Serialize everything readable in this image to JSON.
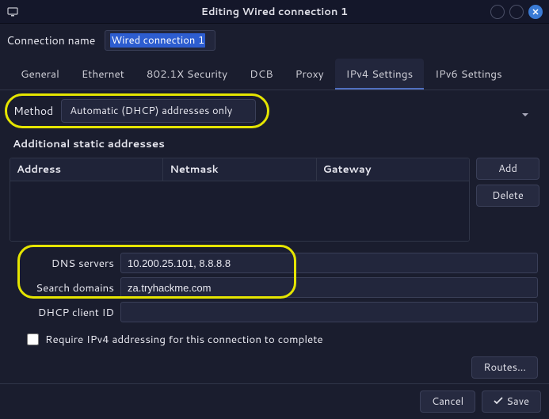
{
  "window": {
    "title": "Editing Wired connection 1"
  },
  "connection": {
    "name_label": "Connection name",
    "name_value": "Wired connection 1"
  },
  "tabs": {
    "general": "General",
    "ethernet": "Ethernet",
    "security": "802.1X Security",
    "dcb": "DCB",
    "proxy": "Proxy",
    "ipv4": "IPv4 Settings",
    "ipv6": "IPv6 Settings"
  },
  "ipv4": {
    "method_label": "Method",
    "method_value": "Automatic (DHCP) addresses only",
    "addresses_label": "Additional static addresses",
    "headers": {
      "address": "Address",
      "netmask": "Netmask",
      "gateway": "Gateway"
    },
    "add_label": "Add",
    "delete_label": "Delete",
    "dns_label": "DNS servers",
    "dns_value": "10.200.25.101, 8.8.8.8",
    "search_label": "Search domains",
    "search_value": "za.tryhackme.com",
    "dhcp_id_label": "DHCP client ID",
    "dhcp_id_value": "",
    "require_label": "Require IPv4 addressing for this connection to complete",
    "routes_label": "Routes…"
  },
  "footer": {
    "cancel": "Cancel",
    "save": "Save"
  }
}
